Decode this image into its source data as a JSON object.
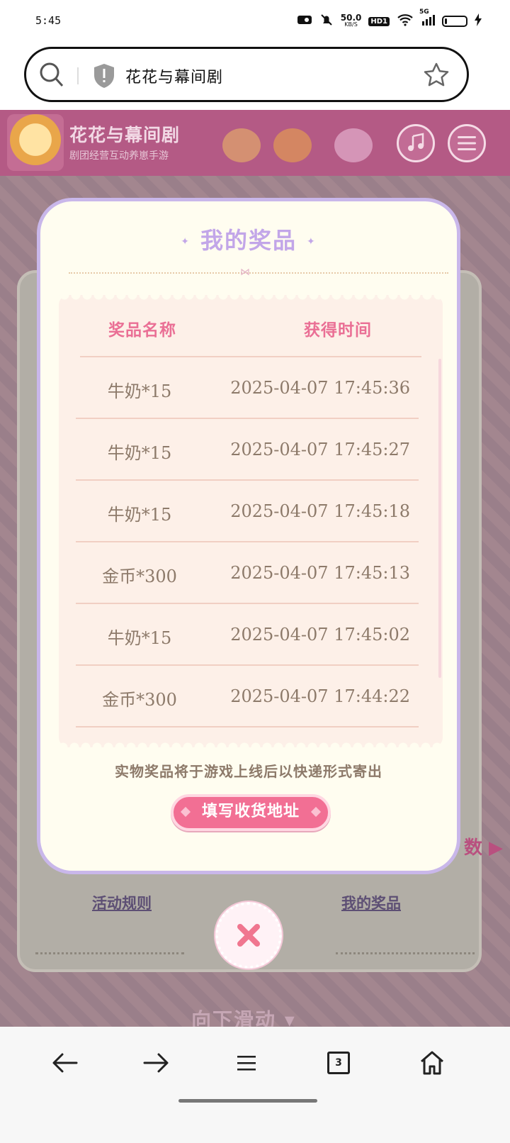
{
  "status": {
    "time": "5:45",
    "net_speed": "50.0",
    "net_unit": "KB/S",
    "hd": "HD1",
    "signal": "5G",
    "battery_level": 0.1
  },
  "address_bar": {
    "text": "花花与幕间剧"
  },
  "banner": {
    "title": "花花与幕间剧",
    "subtitle": "剧团经营互动养崽手游"
  },
  "modal": {
    "title": "我的奖品",
    "columns": [
      "奖品名称",
      "获得时间"
    ],
    "rows": [
      {
        "name": "牛奶*15",
        "time": "2025-04-07 17:45:36"
      },
      {
        "name": "牛奶*15",
        "time": "2025-04-07 17:45:27"
      },
      {
        "name": "牛奶*15",
        "time": "2025-04-07 17:45:18"
      },
      {
        "name": "金币*300",
        "time": "2025-04-07 17:45:13"
      },
      {
        "name": "牛奶*15",
        "time": "2025-04-07 17:45:02"
      },
      {
        "name": "金币*300",
        "time": "2025-04-07 17:44:22"
      }
    ],
    "note": "实物奖品将于游戏上线后以快递形式寄出",
    "button": "填写收货地址"
  },
  "background": {
    "rules_link": "活动规则",
    "prizes_link": "我的奖品",
    "scroll_hint": "向下滑动 ▾",
    "side_text": "数 ▶"
  },
  "bottom_nav": {
    "tab_count": "3"
  },
  "colors": {
    "modal_border": "#c9b7ea",
    "accent_pink": "#f26f94",
    "header_pink": "#ea6f95",
    "text_brown": "#8d7a6a"
  }
}
